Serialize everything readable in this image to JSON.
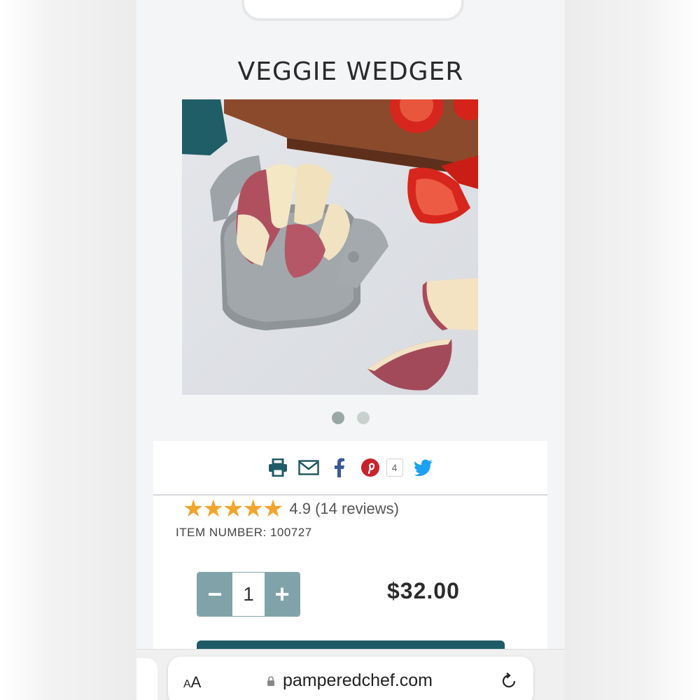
{
  "product": {
    "title": "VEGGIE WEDGER",
    "rating_value": "4.9",
    "rating_text": "4.9 (14 reviews)",
    "stars": "★★★★★",
    "item_number": "ITEM NUMBER: 100727",
    "quantity": "1",
    "price": "$32.00"
  },
  "carousel": {
    "dot_count": 2,
    "active_index": 0
  },
  "share": {
    "icons": [
      "print-icon",
      "email-icon",
      "facebook-icon",
      "pinterest-icon",
      "twitter-icon"
    ],
    "pinterest_count": "4"
  },
  "quantity_controls": {
    "minus": "−",
    "plus": "+"
  },
  "browser": {
    "text_size_label_small": "A",
    "text_size_label_large": "A",
    "url": "pamperedchef.com"
  },
  "colors": {
    "accent": "#1f5b66",
    "stepper": "#7fa3a8",
    "star": "#f2a42c",
    "pinterest": "#c8232c",
    "facebook": "#3b5998",
    "twitter": "#1da1f2"
  }
}
